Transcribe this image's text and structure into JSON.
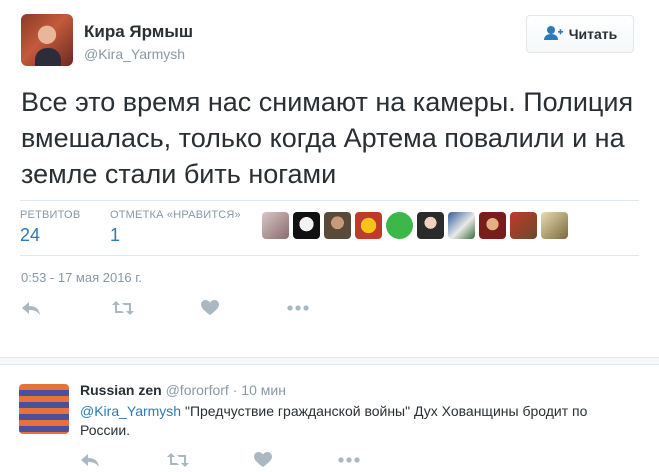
{
  "tweet": {
    "author_name": "Кира Ярмыш",
    "author_handle": "@Kira_Yarmysh",
    "follow_label": "Читать",
    "text": "Все это время нас снимают на камеры. Полиция вмешалась, только когда Артема повалили и на земле стали бить ногами",
    "retweets_label": "РЕТВИТОВ",
    "retweets_count": "24",
    "likes_label": "ОТМЕТКА «НРАВИТСЯ»",
    "likes_count": "1",
    "timestamp": "0:53 - 17 мая 2016 г.",
    "icons": [
      "reply-icon",
      "retweet-icon",
      "heart-icon",
      "more-icon"
    ]
  },
  "reply": {
    "author_name": "Russian zen",
    "author_handle": "@fororforf",
    "separator": "·",
    "time": "10 мин",
    "mention": "@Kira_Yarmysh",
    "text": " \"Предчуствие гражданской войны\" Дух Хованщины бродит по России."
  },
  "colors": {
    "accent": "#2b7bb9",
    "muted": "#8899a6",
    "text": "#292f33",
    "border": "#e1e8ed"
  }
}
